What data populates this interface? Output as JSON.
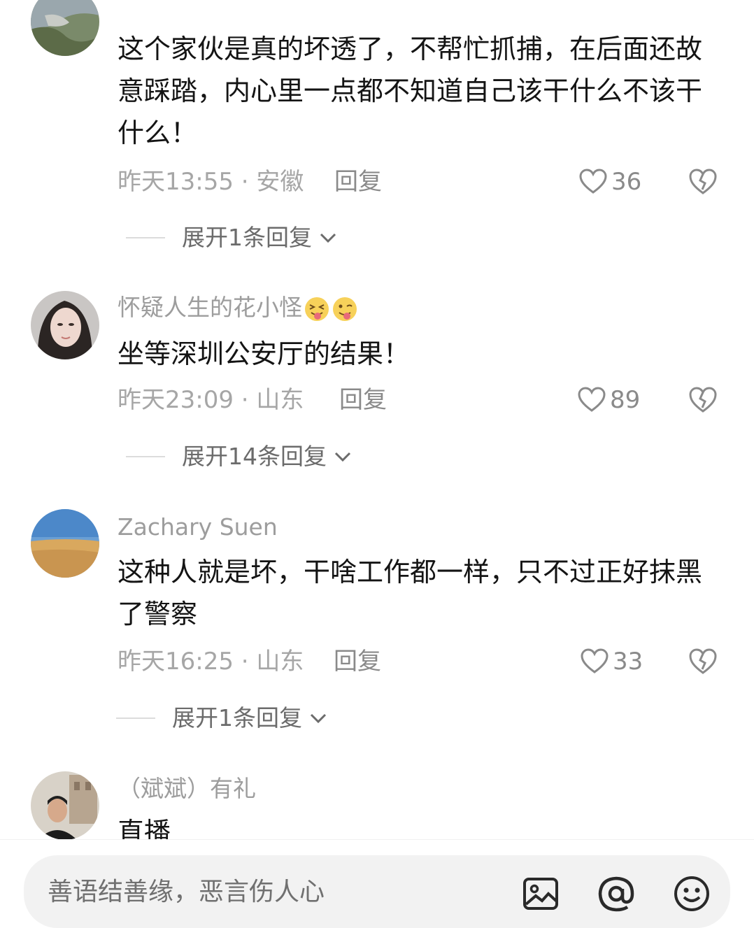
{
  "comments": [
    {
      "username": "",
      "content": "这个家伙是真的坏透了，不帮忙抓捕，在后面还故意踩踏，内心里一点都不知道自己该干什么不该干什么！",
      "time": "昨天13:55",
      "location": "安徽",
      "reply_label": "回复",
      "likes": "36",
      "expand_label": "展开1条回复"
    },
    {
      "username": "怀疑人生的花小怪",
      "username_emojis": [
        "squinting-tongue-emoji",
        "winking-tongue-emoji"
      ],
      "content": "坐等深圳公安厅的结果！",
      "time": "昨天23:09",
      "location": "山东",
      "reply_label": "回复",
      "likes": "89",
      "expand_label": "展开14条回复"
    },
    {
      "username": "Zachary Suen",
      "content": "这种人就是坏，干啥工作都一样，只不过正好抹黑了警察",
      "time": "昨天16:25",
      "location": "山东",
      "reply_label": "回复",
      "likes": "33",
      "expand_label": "展开1条回复"
    },
    {
      "username": "（斌斌）有礼",
      "content": "直播"
    }
  ],
  "meta_separator": " · ",
  "input": {
    "placeholder": "善语结善缘，恶言伤人心"
  },
  "icons": {
    "like": "heart-outline-icon",
    "dislike": "broken-heart-icon",
    "expand": "chevron-down-icon",
    "image": "image-icon",
    "mention": "at-icon",
    "emoji": "smiley-icon"
  },
  "colors": {
    "background": "#ffffff",
    "username": "#9d9d9d",
    "content": "#141414",
    "meta": "#a6a6a6",
    "input_bg": "#f2f2f2"
  }
}
